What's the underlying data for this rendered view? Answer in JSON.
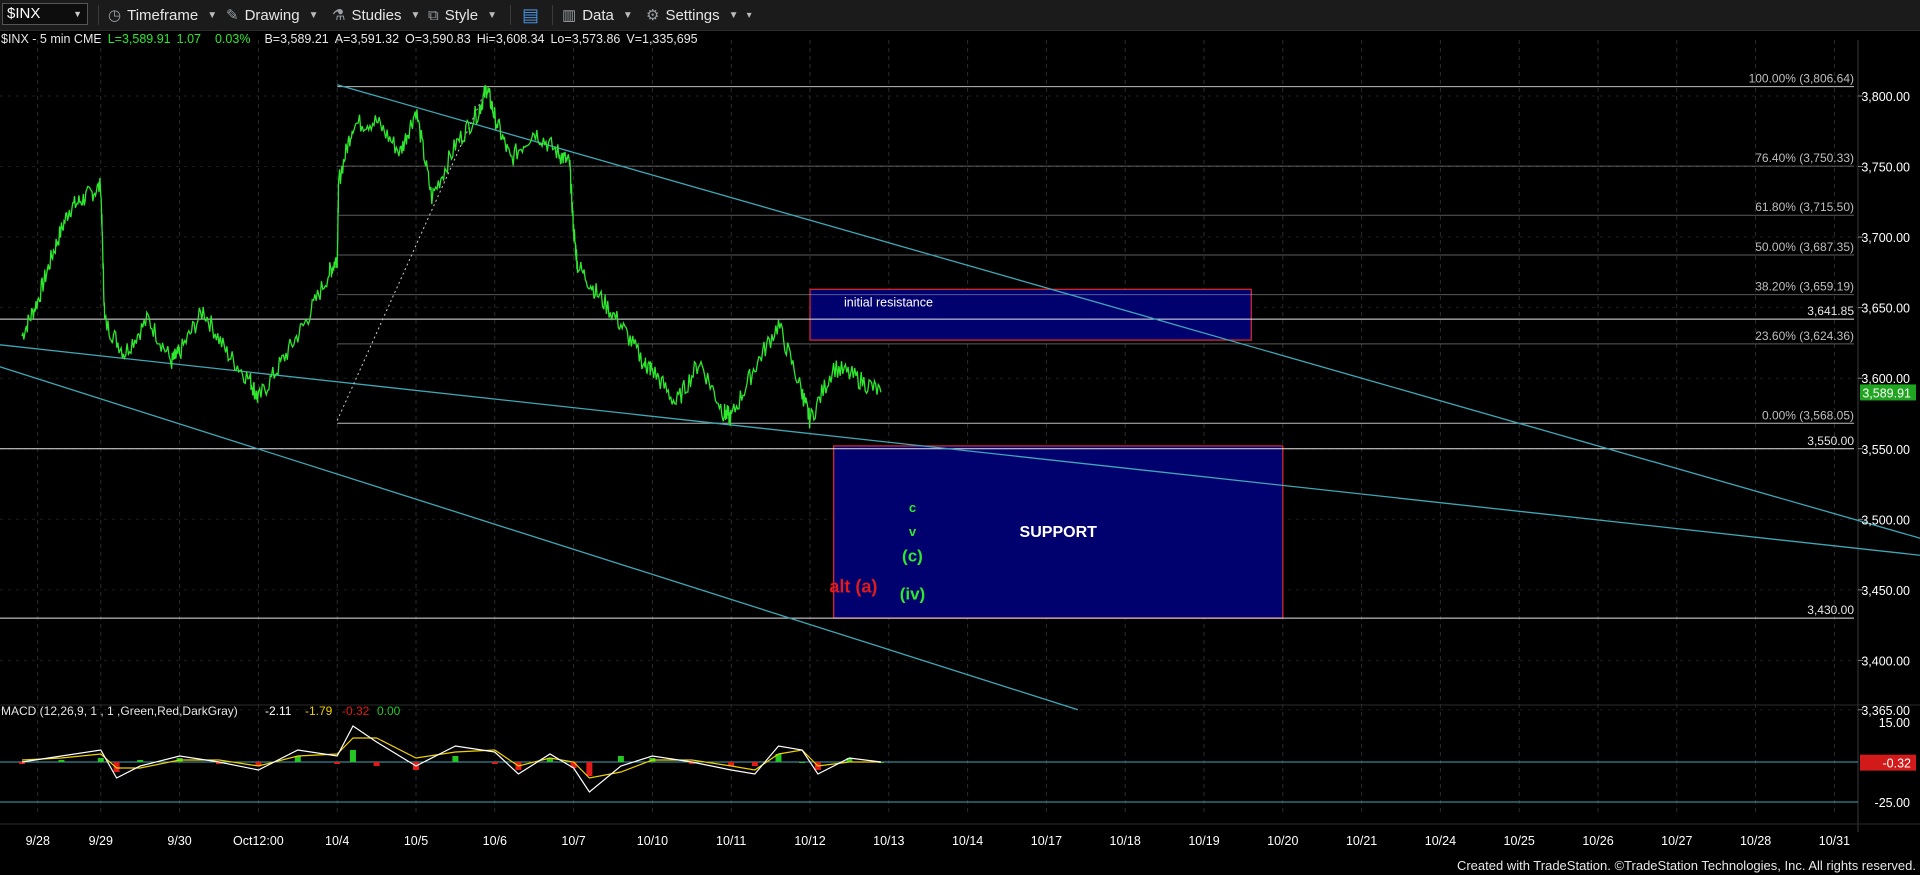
{
  "toolbar": {
    "symbol": "$INX",
    "timeframe_label": "Timeframe",
    "drawing_label": "Drawing",
    "studies_label": "Studies",
    "style_label": "Style",
    "data_label": "Data",
    "settings_label": "Settings"
  },
  "status": {
    "symbol": "$INX - 5 min  CME",
    "last": "L=3,589.91",
    "chg": "1.07",
    "pct": "0.03%",
    "bid": "B=3,589.21",
    "ask": "A=3,591.32",
    "open": "O=3,590.83",
    "high": "Hi=3,608.34",
    "low": "Lo=3,573.86",
    "volume": "V=1,335,695"
  },
  "footer": "Created with TradeStation. ©TradeStation Technologies, Inc. All rights reserved.",
  "colors": {
    "price": "#2ee82e",
    "trendline": "#3fa6b6",
    "box_fill": "#00006e",
    "box_border": "#d22828",
    "fib_line": "#c9c9c9",
    "axis_text": "#ffffff",
    "label_green": "#2ee82e",
    "label_red": "#e11a1a",
    "macd_fast": "#ffffff",
    "macd_slow": "#f0d000",
    "hist_up": "#23c623",
    "hist_down": "#e11a1a"
  },
  "chart_data": {
    "type": "line",
    "title": "",
    "xlabel": "",
    "ylabel": "",
    "ylim": [
      3365,
      3830
    ],
    "y_ticks": [
      "3,800.00",
      "3,750.00",
      "3,700.00",
      "3,650.00",
      "3,600.00",
      "3,550.00",
      "3,500.00",
      "3,450.00",
      "3,400.00",
      "3,365.00"
    ],
    "y_tick_values": [
      3800,
      3750,
      3700,
      3650,
      3600,
      3550,
      3500,
      3450,
      3400,
      3365
    ],
    "x_ticks": [
      "9/28",
      "9/29",
      "9/30",
      "Oct12:00",
      "10/4",
      "10/5",
      "10/6",
      "10/7",
      "10/10",
      "10/11",
      "10/12",
      "10/13",
      "10/14",
      "10/17",
      "10/18",
      "10/19",
      "10/20",
      "10/21",
      "10/24",
      "10/25",
      "10/26",
      "10/27",
      "10/28",
      "10/31"
    ],
    "x_tick_index": [
      0.2,
      1,
      2,
      3,
      4,
      5,
      6,
      7,
      8,
      9,
      10,
      11,
      12,
      13,
      14,
      15,
      16,
      17,
      18,
      19,
      20,
      21,
      22,
      23
    ],
    "series": [
      {
        "x": [
          0,
          0.2,
          0.4,
          0.6,
          0.8,
          1,
          1.05,
          1.3,
          1.6,
          1.9,
          2,
          2.3,
          2.6,
          2.9,
          3,
          3.3,
          3.6,
          3.9,
          4,
          4.02,
          4.2,
          4.5,
          4.8,
          5,
          5.2,
          5.5,
          5.8,
          5.9,
          6,
          6.2,
          6.5,
          6.8,
          6.95,
          7,
          7.05,
          7.3,
          7.6,
          7.9,
          8,
          8.3,
          8.6,
          8.9,
          9,
          9.3,
          9.6,
          9.9,
          10,
          10.3,
          10.6,
          10.9
        ],
        "values": [
          3630,
          3655,
          3690,
          3720,
          3728,
          3736,
          3640,
          3618,
          3642,
          3612,
          3618,
          3648,
          3618,
          3598,
          3585,
          3612,
          3640,
          3675,
          3685,
          3740,
          3780,
          3782,
          3760,
          3790,
          3728,
          3765,
          3790,
          3806,
          3785,
          3755,
          3775,
          3760,
          3752,
          3705,
          3680,
          3660,
          3638,
          3610,
          3606,
          3582,
          3612,
          3576,
          3572,
          3608,
          3638,
          3590,
          3570,
          3608,
          3600,
          3590
        ]
      }
    ],
    "fib_levels": [
      {
        "label": "100.00% (3,806.64)",
        "value": 3806.64
      },
      {
        "label": "76.40% (3,750.33)",
        "value": 3750.33
      },
      {
        "label": "61.80% (3,715.50)",
        "value": 3715.5
      },
      {
        "label": "50.00% (3,687.35)",
        "value": 3687.35
      },
      {
        "label": "38.20% (3,659.19)",
        "value": 3659.19
      },
      {
        "label": "23.60% (3,624.36)",
        "value": 3624.36
      },
      {
        "label": "0.00% (3,568.05)",
        "value": 3568.05
      }
    ],
    "price_levels": [
      {
        "label": "3,641.85",
        "value": 3641.85
      },
      {
        "label": "3,550.00",
        "value": 3550
      },
      {
        "label": "3,430.00",
        "value": 3430
      }
    ],
    "last_price_label": "3,589.91",
    "last_price": 3589.91,
    "resistance_box": {
      "label": "initial resistance",
      "x0": 10,
      "x1": 15.6,
      "y0": 3627,
      "y1": 3663
    },
    "support_box": {
      "label": "SUPPORT",
      "x0": 10.3,
      "x1": 16,
      "y0": 3430,
      "y1": 3552
    },
    "trendlines": [
      {
        "x0": 4,
        "y0": 3808,
        "x1": 24.5,
        "y1": 3480
      },
      {
        "x0": -0.5,
        "y0": 3625,
        "x1": 24.5,
        "y1": 3472
      },
      {
        "x0": -0.5,
        "y0": 3612,
        "x1": 13.4,
        "y1": 3365
      },
      {
        "x0": 4,
        "y0": 3570,
        "x1": 5.9,
        "y1": 3806
      }
    ],
    "wave_labels": [
      {
        "text": "c",
        "x": 11.3,
        "y": 3505,
        "color": "green"
      },
      {
        "text": "v",
        "x": 11.3,
        "y": 3488,
        "color": "green"
      },
      {
        "text": "(c)",
        "x": 11.3,
        "y": 3470,
        "color": "green"
      },
      {
        "text": "alt (a)",
        "x": 10.55,
        "y": 3448,
        "color": "red"
      },
      {
        "text": "(iv)",
        "x": 11.3,
        "y": 3443,
        "color": "green"
      }
    ],
    "macd": {
      "label": "MACD (12,26,9, 1 , 1 ,Green,Red,DarkGray)",
      "values": [
        "-2.11",
        "-1.79",
        "-0.32",
        "0.00"
      ],
      "ylim": [
        -30,
        20
      ],
      "y_ticks": [
        "15.00",
        "-5.00",
        "-25.00"
      ],
      "y_tick_values": [
        15,
        -5,
        -25
      ],
      "current_label": "-0.32",
      "current_value": -0.32,
      "x": [
        0,
        0.5,
        1,
        1.2,
        1.5,
        2,
        2.5,
        3,
        3.5,
        4,
        4.2,
        4.5,
        5,
        5.5,
        6,
        6.3,
        6.7,
        7,
        7.2,
        7.6,
        8,
        8.5,
        9,
        9.3,
        9.6,
        9.9,
        10.1,
        10.5,
        10.9
      ],
      "macd_line": [
        0,
        3,
        6,
        -8,
        -2,
        3,
        0,
        -4,
        6,
        3,
        18,
        10,
        -2,
        8,
        5,
        -6,
        4,
        -3,
        -15,
        -2,
        3,
        0,
        -4,
        -6,
        8,
        6,
        -6,
        2,
        0
      ],
      "signal_line": [
        1,
        2,
        4,
        -3,
        -3,
        1,
        1,
        -2,
        3,
        4,
        12,
        12,
        2,
        5,
        6,
        -2,
        2,
        0,
        -8,
        -5,
        1,
        1,
        -2,
        -4,
        4,
        6,
        -2,
        0,
        0
      ]
    }
  }
}
